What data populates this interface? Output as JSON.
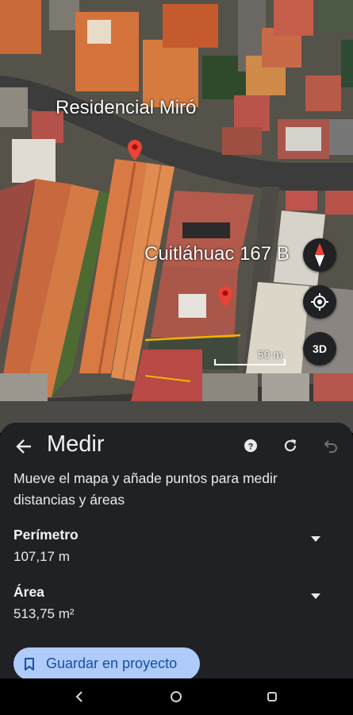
{
  "map": {
    "places": [
      {
        "name": "Residencial Miró"
      },
      {
        "name": "Cuitláhuac 167 B"
      }
    ],
    "scale_label": "50 m",
    "buttons": {
      "compass": "compass-icon",
      "location": "my-location-icon",
      "threed": "3D"
    }
  },
  "panel": {
    "title": "Medir",
    "instructions": "Mueve el mapa y añade puntos para medir distancias y áreas",
    "measurements": [
      {
        "label": "Perímetro",
        "value": "107,17 m"
      },
      {
        "label": "Área",
        "value": "513,75 m²"
      }
    ],
    "actions": {
      "help": "help-icon",
      "refresh": "refresh-icon",
      "undo": "undo-icon"
    },
    "save_label": "Guardar en proyecto"
  },
  "colors": {
    "panel_bg": "#202124",
    "save_bg": "#aecbfa",
    "save_text": "#174ea6",
    "pin": "#ea4335",
    "measure_line": "#f4b400"
  }
}
